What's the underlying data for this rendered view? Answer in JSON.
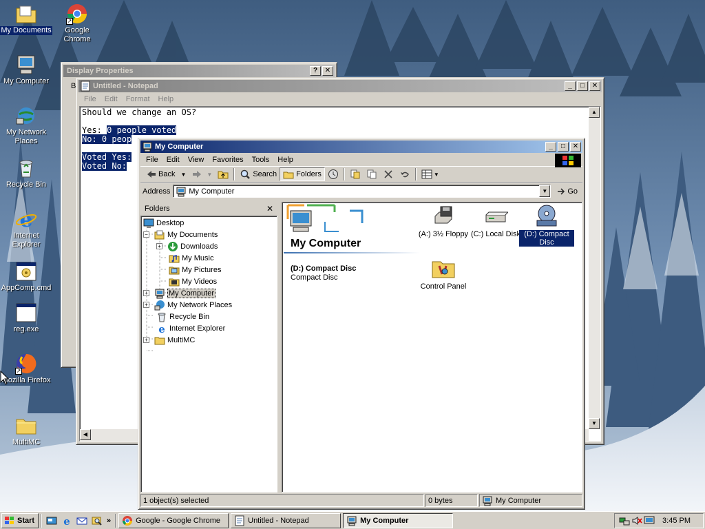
{
  "desktop": {
    "icons": [
      {
        "label": "My Documents",
        "icon": "my-documents-icon"
      },
      {
        "label": "Google Chrome",
        "icon": "chrome-icon"
      },
      {
        "label": "My Computer",
        "icon": "my-computer-icon"
      },
      {
        "label": "My Network Places",
        "icon": "network-places-icon"
      },
      {
        "label": "Recycle Bin",
        "icon": "recycle-bin-icon"
      },
      {
        "label": "Internet Explorer",
        "icon": "internet-explorer-icon"
      },
      {
        "label": "AppComp.cmd",
        "icon": "cmd-file-icon"
      },
      {
        "label": "reg.exe",
        "icon": "exe-file-icon"
      },
      {
        "label": "Mozilla Firefox",
        "icon": "firefox-icon"
      },
      {
        "label": "MultiMC",
        "icon": "folder-icon"
      }
    ]
  },
  "display_properties": {
    "title": "Display Properties",
    "tab_initial": "B"
  },
  "notepad": {
    "title": "Untitled - Notepad",
    "menu": [
      "File",
      "Edit",
      "Format",
      "Help"
    ],
    "lines": {
      "l1": "Should we change an OS?",
      "l3a": "Yes: ",
      "l3b": "0 people voted",
      "l4": "No: 0 peop",
      "l6": "Voted Yes:",
      "l7": "Voted No:"
    }
  },
  "my_computer": {
    "title": "My Computer",
    "menu": [
      "File",
      "Edit",
      "View",
      "Favorites",
      "Tools",
      "Help"
    ],
    "toolbar": {
      "back": "Back",
      "search": "Search",
      "folders": "Folders"
    },
    "address": {
      "label": "Address",
      "value": "My Computer",
      "go": "Go"
    },
    "folders_pane": {
      "title": "Folders",
      "tree": [
        {
          "label": "Desktop"
        },
        {
          "label": "My Documents"
        },
        {
          "label": "Downloads"
        },
        {
          "label": "My Music"
        },
        {
          "label": "My Pictures"
        },
        {
          "label": "My Videos"
        },
        {
          "label": "My Computer"
        },
        {
          "label": "My Network Places"
        },
        {
          "label": "Recycle Bin"
        },
        {
          "label": "Internet Explorer"
        },
        {
          "label": "MultiMC"
        }
      ]
    },
    "content": {
      "heading": "My Computer",
      "selected_name": "(D:) Compact Disc",
      "selected_type": "Compact Disc",
      "items": [
        {
          "label": "(A:) 3½ Floppy",
          "icon": "floppy-drive-icon"
        },
        {
          "label": "(C:) Local Disk",
          "icon": "local-disk-icon"
        },
        {
          "label": "(D:) Compact Disc",
          "icon": "cd-drive-icon",
          "selected": true
        },
        {
          "label": "Control Panel",
          "icon": "control-panel-icon"
        }
      ]
    },
    "status": {
      "selection": "1 object(s) selected",
      "size": "0 bytes",
      "location": "My Computer"
    }
  },
  "taskbar": {
    "start": "Start",
    "tasks": [
      {
        "label": "Google - Google Chrome"
      },
      {
        "label": "Untitled - Notepad"
      },
      {
        "label": "My Computer",
        "active": true
      }
    ],
    "clock": "3:45 PM"
  },
  "colors": {
    "title_active": "#0a246a",
    "title_inactive": "#808080",
    "face": "#d4d0c8",
    "selection": "#0a246a"
  }
}
